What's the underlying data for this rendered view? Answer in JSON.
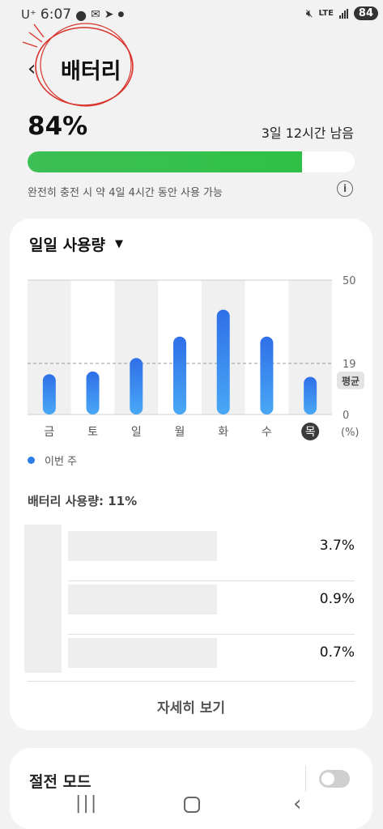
{
  "status_bar": {
    "carrier": "U⁺",
    "time": "6:07",
    "network": "LTE",
    "battery": "84"
  },
  "header": {
    "title": "배터리",
    "back_icon": "back-chevron-icon"
  },
  "battery": {
    "percent_text": "84%",
    "level": 0.84,
    "remaining": "3일 12시간 남음",
    "full_charge_note": "완전히 충전 시 약 4일 4시간 동안 사용 가능",
    "bar_color": "#34c04f"
  },
  "daily_usage": {
    "dropdown_label": "일일 사용량",
    "legend_label": "이번 주",
    "accent": "#2c7de6"
  },
  "chart_data": {
    "type": "bar",
    "categories": [
      "금",
      "토",
      "일",
      "월",
      "화",
      "수",
      "목"
    ],
    "values": [
      15,
      16,
      21,
      29,
      39,
      29,
      14
    ],
    "ylim": [
      0,
      50
    ],
    "yticks": [
      "50",
      "19",
      "0"
    ],
    "ylabel": "(%)",
    "average": 19,
    "average_label": "평균",
    "highlight_category": "목",
    "series": [
      {
        "name": "이번 주",
        "values": [
          15,
          16,
          21,
          29,
          39,
          29,
          14
        ]
      }
    ]
  },
  "battery_usage": {
    "title": "배터리 사용량: 11%",
    "apps": [
      {
        "value": "3.7%"
      },
      {
        "value": "0.9%"
      },
      {
        "value": "0.7%"
      }
    ],
    "more_label": "자세히 보기"
  },
  "power_saving": {
    "label": "절전 모드",
    "enabled": false
  }
}
